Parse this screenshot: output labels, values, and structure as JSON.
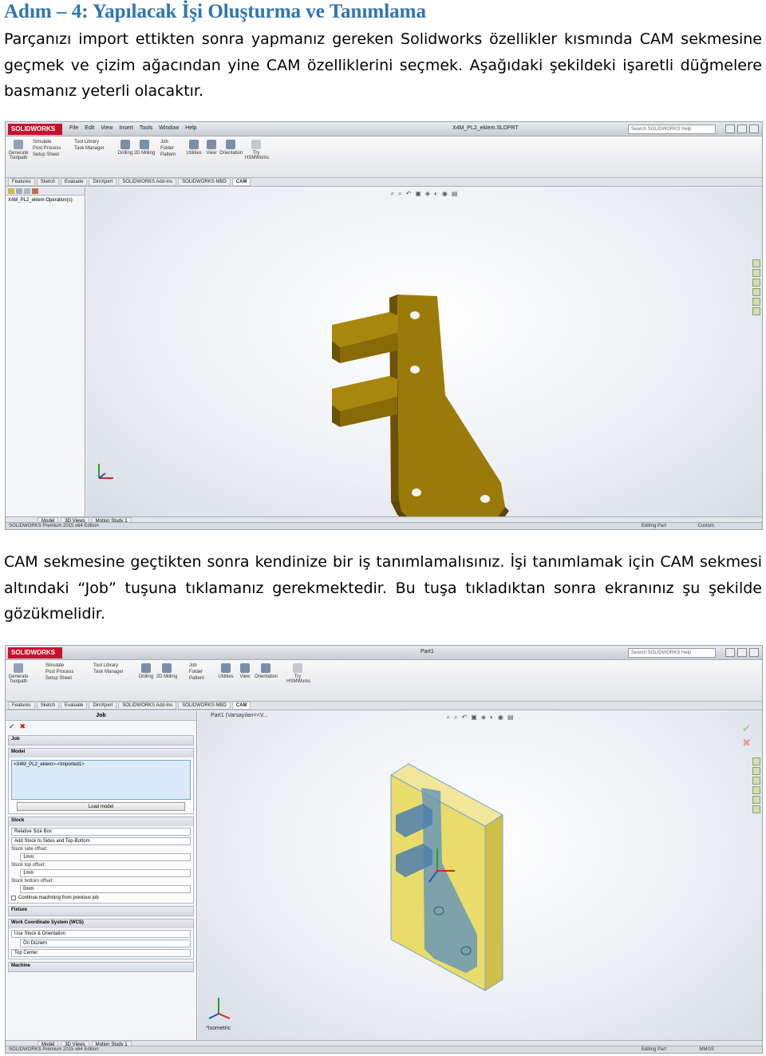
{
  "heading": "Adım – 4: Yapılacak İşi Oluşturma ve Tanımlama",
  "paragraph1": "Parçanızı import ettikten sonra yapmanız gereken Solidworks özellikler kısmında CAM sekmesine geçmek ve çizim ağacından yine CAM özelliklerini seçmek. Aşağıdaki şekildeki işaretli düğmelere basmanız yeterli olacaktır.",
  "paragraph2": "CAM sekmesine geçtikten sonra kendinize bir iş tanımlamalısınız. İşi tanımlamak için CAM sekmesi altındaki “Job” tuşuna tıklamanız gerekmektedir. Bu tuşa tıkladıktan sonra ekranınız şu şekilde gözükmelidir.",
  "colors": {
    "heading": "#2e74b5",
    "part_gold": "#9a7a08",
    "stock_yellow": "#e8dc6a",
    "part_blue": "#5a8fc0"
  },
  "screenshot1": {
    "logo": "SOLIDWORKS",
    "menu": [
      "File",
      "Edit",
      "View",
      "Insert",
      "Tools",
      "Window",
      "Help"
    ],
    "document_title": "X4M_PL2_eklem.SLDPRT",
    "help_search": "Search SOLIDWORKS Help",
    "ribbon": {
      "generate": "Generate Toolpath",
      "simulate": "Simulate",
      "post_process": "Post Process",
      "setup_sheet": "Setup Sheet",
      "tool_library": "Tool Library",
      "task_manager": "Task Manager",
      "drilling": "Drilling",
      "milling_2d": "2D Milling",
      "job": "Job",
      "folder": "Folder",
      "pattern": "Pattern",
      "utilities": "Utilities",
      "view": "View",
      "orientation": "Orientation",
      "try_hsm": "Try HSMWorks"
    },
    "tabs": [
      "Features",
      "Sketch",
      "Evaluate",
      "DimXpert",
      "SOLIDWORKS Add-Ins",
      "SOLIDWORKS MBD",
      "CAM"
    ],
    "tree_item": "X4M_PL2_eklem Operation(s)",
    "bottom_tabs": [
      "Model",
      "3D Views",
      "Motion Study 1"
    ],
    "status_left": "SOLIDWORKS Premium 2015 x64 Edition",
    "status_mid": "Editing Part",
    "status_right": "Custom"
  },
  "screenshot2": {
    "logo": "SOLIDWORKS",
    "document_title": "Part1",
    "help_search": "Search SOLIDWORKS Help",
    "tabs": [
      "Features",
      "Sketch",
      "Evaluate",
      "DimXpert",
      "SOLIDWORKS Add-Ins",
      "SOLIDWORKS MBD",
      "CAM"
    ],
    "panel_title": "Job",
    "section_job": "Job",
    "section_model": "Model",
    "model_item": "<X4M_PL2_eklem>-<Imported1>",
    "load_model": "Load model",
    "section_stock": "Stock",
    "stock_mode": "Relative Size Box",
    "stock_add": "Add Stock to Sides and Top-Bottom",
    "side_offset_label": "Stock side offset:",
    "side_offset": "1mm",
    "top_offset_label": "Stock top offset:",
    "top_offset": "1mm",
    "bottom_offset_label": "Stock bottom offset:",
    "bottom_offset": "0mm",
    "continue_machining": "Continue machining from previous job",
    "section_fixture": "Fixture",
    "section_wcs": "Work Coordinate System (WCS)",
    "wcs_mode": "Use Stock & Orientation",
    "wcs_plane": "Ön Düzlem",
    "wcs_origin": "Top Center",
    "section_machine": "Machine",
    "breadcrumb": "Part1 (Varsayılan<<V...",
    "view_label": "*Isometric",
    "bottom_tabs": [
      "Model",
      "3D Views",
      "Motion Study 1"
    ],
    "status_left": "SOLIDWORKS Premium 2015 x64 Edition",
    "status_mid": "Editing Part",
    "status_right": "MMGS"
  }
}
